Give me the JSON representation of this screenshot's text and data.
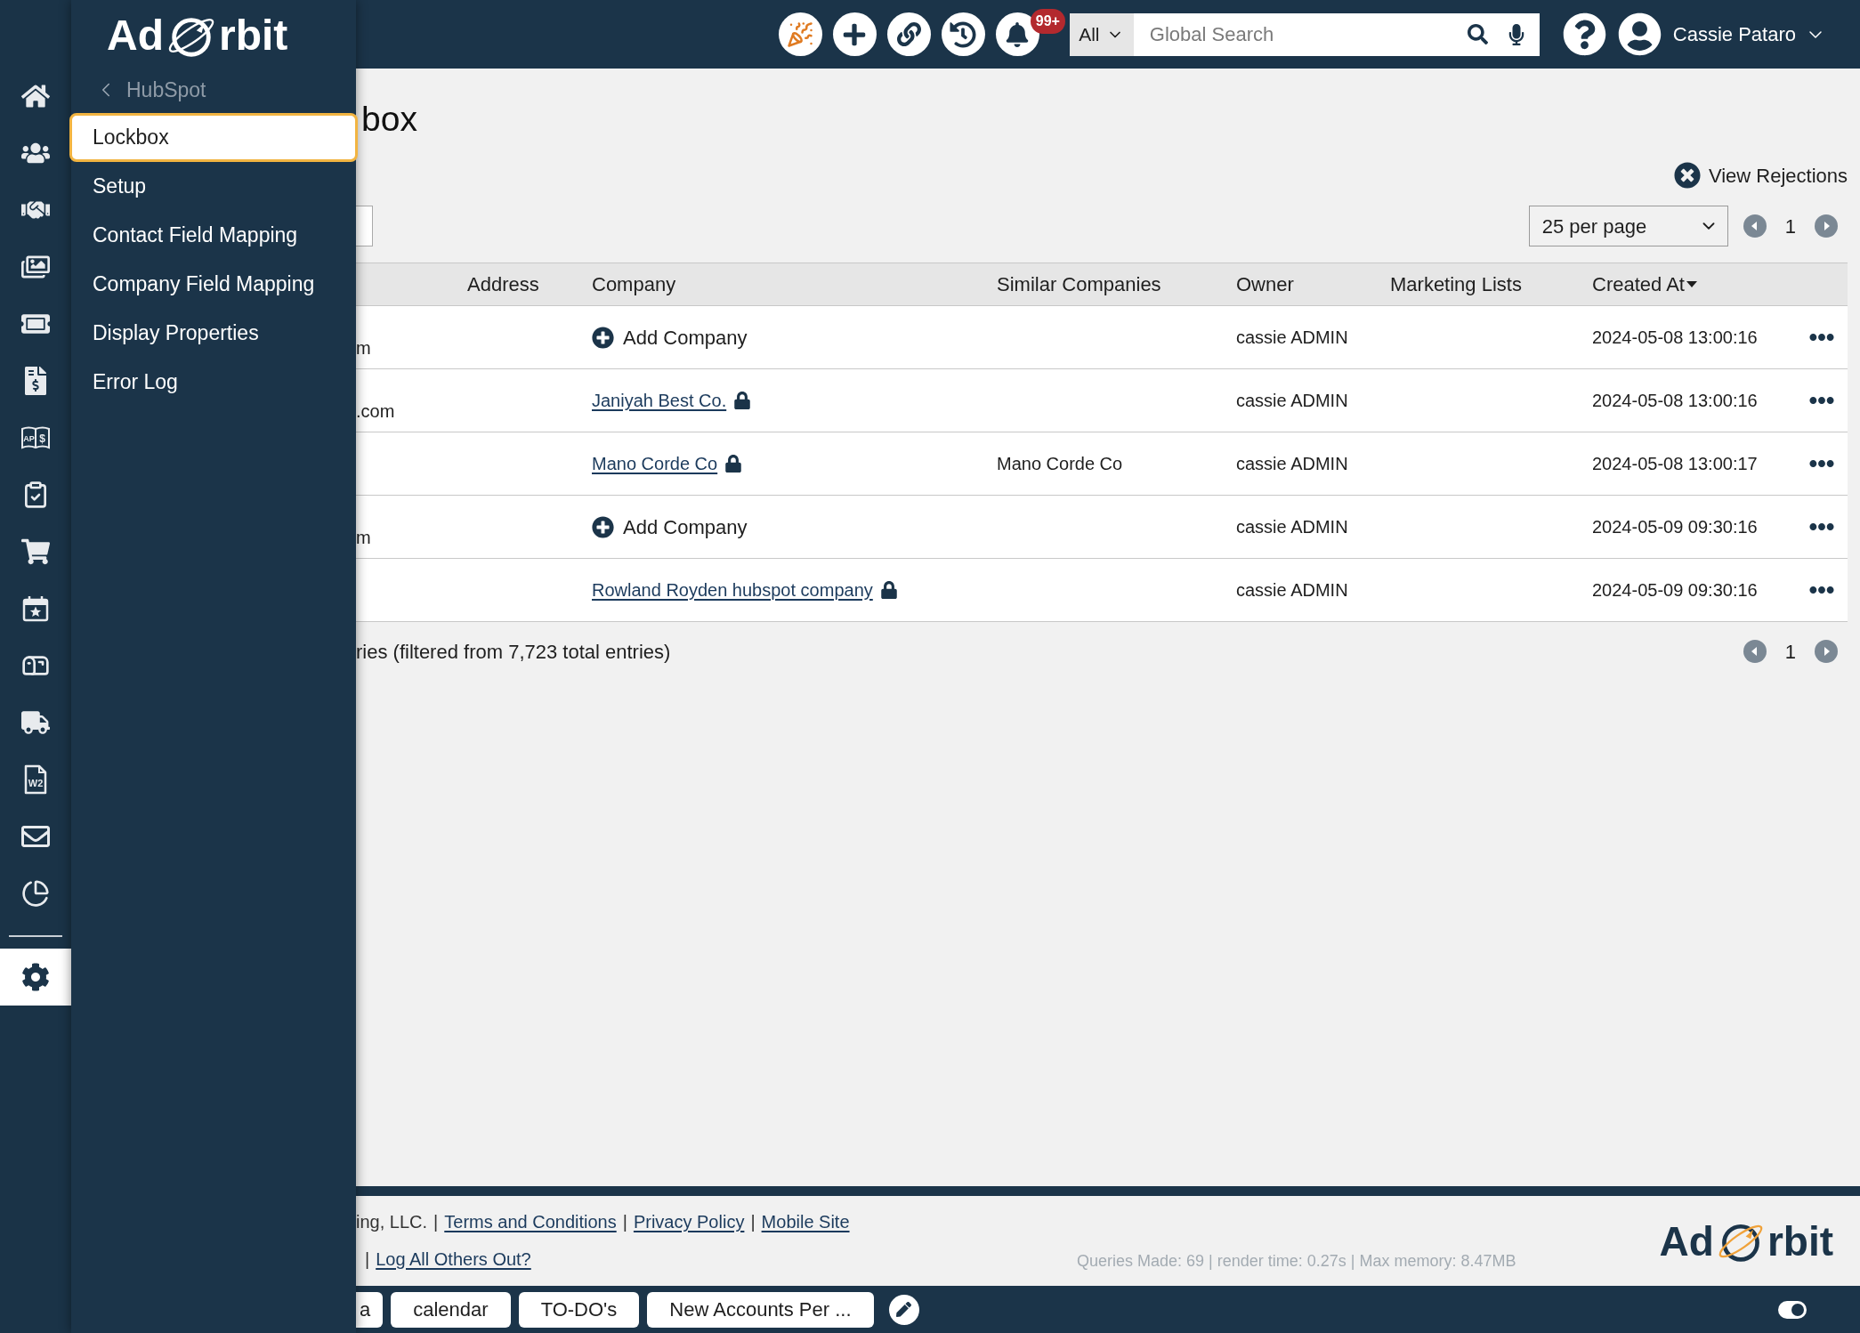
{
  "icon_rail": {
    "items": [
      {
        "selected": false
      },
      {
        "selected": false
      },
      {
        "selected": false
      },
      {
        "selected": false
      },
      {
        "selected": false
      },
      {
        "selected": false
      },
      {
        "selected": false,
        "icon_text": [
          "AP",
          "$"
        ]
      },
      {
        "selected": false
      },
      {
        "selected": false
      },
      {
        "selected": false
      },
      {
        "selected": false
      },
      {
        "selected": false
      },
      {
        "selected": false,
        "icon_text": [
          "W2"
        ]
      },
      {
        "selected": false
      },
      {
        "selected": false
      }
    ],
    "settings": {
      "selected": true
    }
  },
  "sidebar": {
    "logo": {
      "left": "Ad",
      "right": "rbit"
    },
    "back_link": "HubSpot",
    "items": [
      {
        "label": "Lockbox",
        "selected": true
      },
      {
        "label": "Setup",
        "selected": false
      },
      {
        "label": "Contact Field Mapping",
        "selected": false
      },
      {
        "label": "Company Field Mapping",
        "selected": false
      },
      {
        "label": "Display Properties",
        "selected": false
      },
      {
        "label": "Error Log",
        "selected": false
      }
    ]
  },
  "topbar": {
    "notification_badge": "99+",
    "search": {
      "scope": "All",
      "placeholder": "Global Search"
    },
    "user_name": "Cassie Pataro"
  },
  "page": {
    "title": "box",
    "view_rejections": "View Rejections",
    "per_page": "25 per page",
    "page_number": "1"
  },
  "table": {
    "columns": [
      {
        "label": "Address",
        "sorted": false
      },
      {
        "label": "Company",
        "sorted": false
      },
      {
        "label": "Similar Companies",
        "sorted": false
      },
      {
        "label": "Owner",
        "sorted": false
      },
      {
        "label": "Marketing Lists",
        "sorted": false
      },
      {
        "label": "Created At",
        "sorted": true
      }
    ],
    "rows": [
      {
        "hidden_column": "m",
        "company": {
          "kind": "add",
          "text": "Add Company"
        },
        "owner": "cassie ADMIN",
        "created_at": "2024-05-08 13:00:16"
      },
      {
        "hidden_column": ".com",
        "company": {
          "kind": "link",
          "text": "Janiyah Best Co.",
          "locked": true
        },
        "owner": "cassie ADMIN",
        "created_at": "2024-05-08 13:00:16"
      },
      {
        "company": {
          "kind": "link",
          "text": "Mano Corde Co",
          "locked": true
        },
        "similar_companies": "Mano Corde Co",
        "owner": "cassie ADMIN",
        "created_at": "2024-05-08 13:00:17"
      },
      {
        "hidden_column": "m",
        "company": {
          "kind": "add",
          "text": "Add Company"
        },
        "owner": "cassie ADMIN",
        "created_at": "2024-05-09 09:30:16"
      },
      {
        "company": {
          "kind": "link",
          "text": "Rowland Royden hubspot company",
          "locked": true
        },
        "owner": "cassie ADMIN",
        "created_at": "2024-05-09 09:30:16"
      }
    ]
  },
  "entries_info": "ries (filtered from 7,723 total entries)",
  "bottom_pagination": {
    "page_number": "1"
  },
  "footer": {
    "line_1": [
      {
        "kind": "text",
        "text": "ing, LLC."
      },
      {
        "kind": "separator",
        "text": "|"
      },
      {
        "kind": "link",
        "text": "Terms and Conditions"
      },
      {
        "kind": "separator",
        "text": "|"
      },
      {
        "kind": "link",
        "text": "Privacy Policy"
      },
      {
        "kind": "separator",
        "text": "|"
      },
      {
        "kind": "link",
        "text": "Mobile Site"
      }
    ],
    "line_2": [
      {
        "kind": "separator",
        "text": "|"
      },
      {
        "kind": "link",
        "text": "Log All Others Out?"
      }
    ],
    "stats": "Queries Made: 69 | render time: 0.27s | Max memory: 8.47MB",
    "logo": {
      "left": "Ad",
      "right": "rbit"
    }
  },
  "taskbar": {
    "tabs": [
      "a",
      "calendar",
      "TO-DO's",
      "New Accounts Per ..."
    ]
  }
}
